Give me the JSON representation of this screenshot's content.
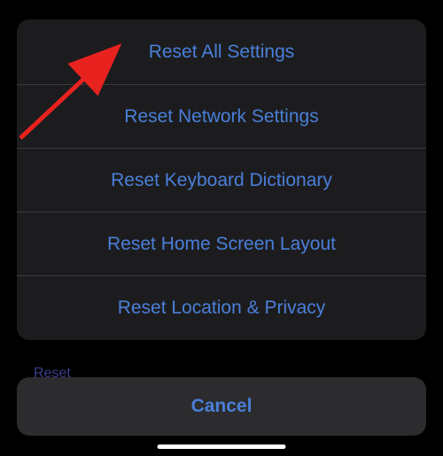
{
  "background": {
    "text": "Reset"
  },
  "actionSheet": {
    "items": [
      {
        "label": "Reset All Settings"
      },
      {
        "label": "Reset Network Settings"
      },
      {
        "label": "Reset Keyboard Dictionary"
      },
      {
        "label": "Reset Home Screen Layout"
      },
      {
        "label": "Reset Location & Privacy"
      }
    ]
  },
  "cancel": {
    "label": "Cancel"
  }
}
